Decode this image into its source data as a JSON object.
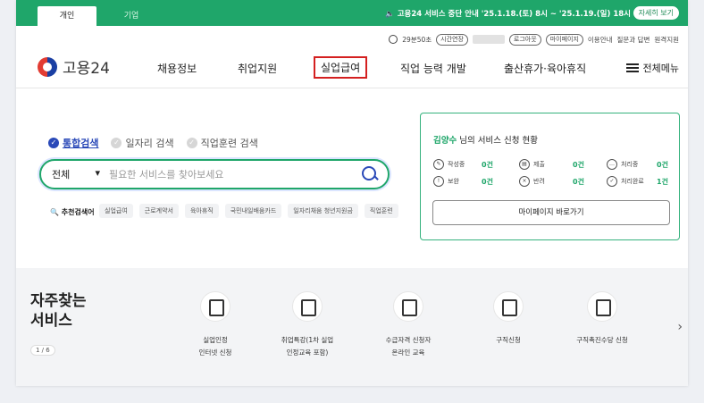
{
  "topbar": {
    "tabs": [
      {
        "label": "개인"
      },
      {
        "label": "기업"
      }
    ],
    "notice": "🔈 고용24 서비스 중단 안내 '25.1.18.(토) 8시 ~ '25.1.19.(일) 18시",
    "notice_button": "자세히 보기"
  },
  "util": {
    "timer": "29분50초",
    "extend": "시간연장",
    "logout": "로그아웃",
    "mypage": "마이페이지",
    "links": [
      "이용안내",
      "질문과 답변",
      "원격지원"
    ]
  },
  "nav": {
    "logo_text": "고용24",
    "items": [
      "채용정보",
      "취업지원",
      "실업급여",
      "직업 능력 개발",
      "출산휴가·육아휴직"
    ],
    "all_menu": "전체메뉴"
  },
  "search": {
    "radios": [
      "통합검색",
      "일자리 검색",
      "직업훈련 검색"
    ],
    "select_value": "전체",
    "placeholder": "필요한 서비스를 찾아보세요",
    "rec_label": "추천검색어",
    "chips": [
      "실업급여",
      "근로계약서",
      "육아휴직",
      "국민내일배움카드",
      "일자리채움 청년지원금",
      "직업훈련"
    ]
  },
  "status": {
    "name": "김양수",
    "title_suffix": " 님의 서비스 신청 현황",
    "items": [
      {
        "label": "작성중",
        "count": "0건"
      },
      {
        "label": "제출",
        "count": "0건"
      },
      {
        "label": "처리중",
        "count": "0건"
      },
      {
        "label": "보완",
        "count": "0건"
      },
      {
        "label": "반려",
        "count": "0건"
      },
      {
        "label": "처리완료",
        "count": "1건"
      }
    ],
    "mypage_button": "마이페이지 바로가기"
  },
  "services": {
    "title_line1": "자주찾는",
    "title_line2": "서비스",
    "pager": "1 / 6",
    "items": [
      {
        "l1": "실업인정",
        "l2": "인터넷 신청"
      },
      {
        "l1": "취업특강(1차 실업",
        "l2": "인정교육 포함)"
      },
      {
        "l1": "수급자격 신청자",
        "l2": "온라인 교육"
      },
      {
        "l1": "구직신청",
        "l2": ""
      },
      {
        "l1": "구직촉진수당 신청",
        "l2": ""
      }
    ]
  }
}
